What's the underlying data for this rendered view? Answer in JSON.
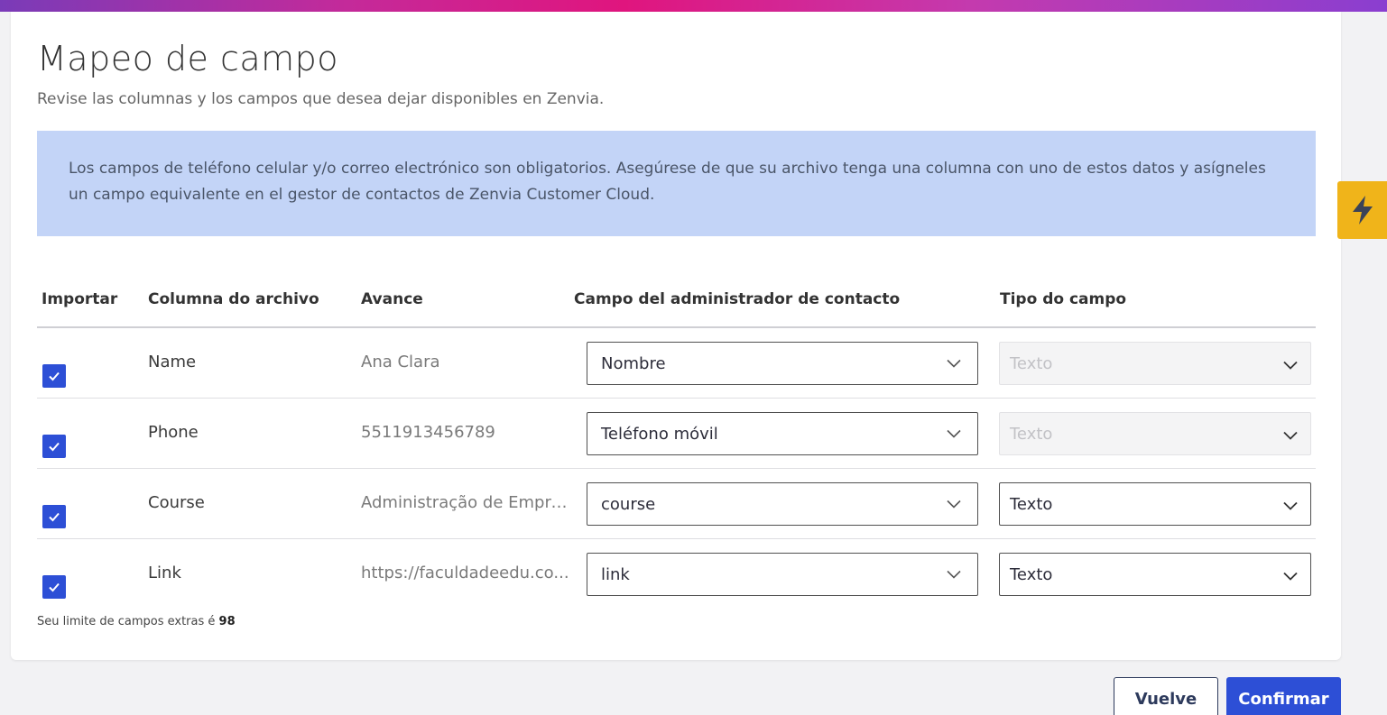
{
  "header": {
    "title": "Mapeo de campo",
    "subtitle": "Revise las columnas y los campos que desea dejar disponibles en Zenvia."
  },
  "info": {
    "text": "Los campos de teléfono celular y/o correo electrónico son obligatorios. Asegúrese de que su archivo tenga una columna con uno de estos datos y asígneles un campo equivalente en el gestor de contactos de Zenvia Customer Cloud."
  },
  "table": {
    "headers": {
      "importar": "Importar",
      "columna": "Columna do archivo",
      "avance": "Avance",
      "campo": "Campo del administrador de contacto",
      "tipo": "Tipo do campo"
    },
    "rows": [
      {
        "checked": true,
        "column": "Name",
        "preview": "Ana Clara",
        "field": "Nombre",
        "type": "Texto",
        "type_disabled": true
      },
      {
        "checked": true,
        "column": "Phone",
        "preview": "5511913456789",
        "field": "Teléfono móvil",
        "type": "Texto",
        "type_disabled": true
      },
      {
        "checked": true,
        "column": "Course",
        "preview": "Administração de Empre...",
        "field": "course",
        "type": "Texto",
        "type_disabled": false
      },
      {
        "checked": true,
        "column": "Link",
        "preview": "https://faculdadeedu.co...",
        "field": "link",
        "type": "Texto",
        "type_disabled": false
      }
    ]
  },
  "footnote": {
    "text": "Seu limite de campos extras é ",
    "limit": "98"
  },
  "buttons": {
    "back": "Vuelve",
    "confirm": "Confirmar"
  },
  "colors": {
    "accent": "#2d4fd6",
    "info_bg": "#c3d4f7",
    "bolt_tab": "#f0b41a"
  },
  "icons": {
    "checkbox": "checkmark-icon",
    "select": "chevron-down-icon",
    "side_tab": "lightning-bolt-icon"
  }
}
